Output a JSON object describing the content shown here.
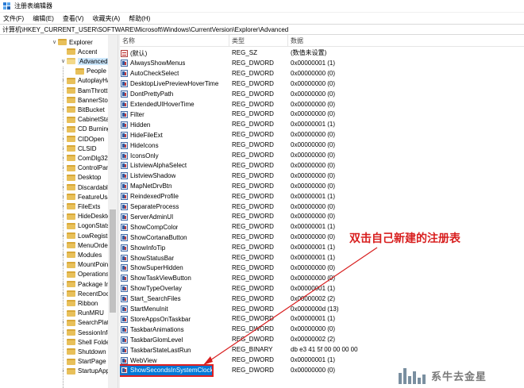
{
  "window": {
    "title": "注册表编辑器"
  },
  "menu": [
    "文件(F)",
    "编辑(E)",
    "查看(V)",
    "收藏夹(A)",
    "帮助(H)"
  ],
  "address": "计算机\\HKEY_CURRENT_USER\\SOFTWARE\\Microsoft\\Windows\\CurrentVersion\\Explorer\\Advanced",
  "tree": {
    "items": [
      {
        "label": "Explorer",
        "indent": 0,
        "chevron": "down",
        "selected": false
      },
      {
        "label": "Accent",
        "indent": 1,
        "chevron": "",
        "selected": false
      },
      {
        "label": "Advanced",
        "indent": 1,
        "chevron": "down",
        "selected": true
      },
      {
        "label": "People",
        "indent": 2,
        "chevron": "",
        "selected": false
      },
      {
        "label": "AutoplayHa",
        "indent": 1,
        "chevron": "right",
        "selected": false
      },
      {
        "label": "BamThrottl",
        "indent": 1,
        "chevron": "",
        "selected": false
      },
      {
        "label": "BannerStor",
        "indent": 1,
        "chevron": "",
        "selected": false
      },
      {
        "label": "BitBucket",
        "indent": 1,
        "chevron": "right",
        "selected": false
      },
      {
        "label": "CabinetSta",
        "indent": 1,
        "chevron": "",
        "selected": false
      },
      {
        "label": "CD Burning",
        "indent": 1,
        "chevron": "right",
        "selected": false
      },
      {
        "label": "CIDOpen",
        "indent": 1,
        "chevron": "right",
        "selected": false
      },
      {
        "label": "CLSID",
        "indent": 1,
        "chevron": "right",
        "selected": false
      },
      {
        "label": "ComDlg32",
        "indent": 1,
        "chevron": "right",
        "selected": false
      },
      {
        "label": "ControlPan",
        "indent": 1,
        "chevron": "right",
        "selected": false
      },
      {
        "label": "Desktop",
        "indent": 1,
        "chevron": "",
        "selected": false
      },
      {
        "label": "Discardabl",
        "indent": 1,
        "chevron": "right",
        "selected": false
      },
      {
        "label": "FeatureUsa",
        "indent": 1,
        "chevron": "right",
        "selected": false
      },
      {
        "label": "FileExts",
        "indent": 1,
        "chevron": "right",
        "selected": false
      },
      {
        "label": "HideDeskto",
        "indent": 1,
        "chevron": "right",
        "selected": false
      },
      {
        "label": "LogonStats",
        "indent": 1,
        "chevron": "",
        "selected": false
      },
      {
        "label": "LowRegistr",
        "indent": 1,
        "chevron": "right",
        "selected": false
      },
      {
        "label": "MenuOrde",
        "indent": 1,
        "chevron": "right",
        "selected": false
      },
      {
        "label": "Modules",
        "indent": 1,
        "chevron": "right",
        "selected": false
      },
      {
        "label": "MountPoin",
        "indent": 1,
        "chevron": "right",
        "selected": false
      },
      {
        "label": "Operations",
        "indent": 1,
        "chevron": "",
        "selected": false
      },
      {
        "label": "Package In",
        "indent": 1,
        "chevron": "right",
        "selected": false
      },
      {
        "label": "RecentDoc",
        "indent": 1,
        "chevron": "right",
        "selected": false
      },
      {
        "label": "Ribbon",
        "indent": 1,
        "chevron": "",
        "selected": false
      },
      {
        "label": "RunMRU",
        "indent": 1,
        "chevron": "",
        "selected": false
      },
      {
        "label": "SearchPlatf",
        "indent": 1,
        "chevron": "right",
        "selected": false
      },
      {
        "label": "SessionInfo",
        "indent": 1,
        "chevron": "right",
        "selected": false
      },
      {
        "label": "Shell Folde",
        "indent": 1,
        "chevron": "",
        "selected": false
      },
      {
        "label": "Shutdown",
        "indent": 1,
        "chevron": "",
        "selected": false
      },
      {
        "label": "StartPage",
        "indent": 1,
        "chevron": "",
        "selected": false
      },
      {
        "label": "StartupApp",
        "indent": 1,
        "chevron": "right",
        "selected": false
      }
    ]
  },
  "list": {
    "columns": [
      "名称",
      "类型",
      "数据"
    ],
    "rows": [
      {
        "name": "(默认)",
        "type": "REG_SZ",
        "data": "(数值未设置)",
        "kind": "str"
      },
      {
        "name": "AlwaysShowMenus",
        "type": "REG_DWORD",
        "data": "0x00000001 (1)",
        "kind": "dword"
      },
      {
        "name": "AutoCheckSelect",
        "type": "REG_DWORD",
        "data": "0x00000000 (0)",
        "kind": "dword"
      },
      {
        "name": "DesktopLivePreviewHoverTime",
        "type": "REG_DWORD",
        "data": "0x00000000 (0)",
        "kind": "dword"
      },
      {
        "name": "DontPrettyPath",
        "type": "REG_DWORD",
        "data": "0x00000000 (0)",
        "kind": "dword"
      },
      {
        "name": "ExtendedUIHoverTime",
        "type": "REG_DWORD",
        "data": "0x00000000 (0)",
        "kind": "dword"
      },
      {
        "name": "Filter",
        "type": "REG_DWORD",
        "data": "0x00000000 (0)",
        "kind": "dword"
      },
      {
        "name": "Hidden",
        "type": "REG_DWORD",
        "data": "0x00000001 (1)",
        "kind": "dword"
      },
      {
        "name": "HideFileExt",
        "type": "REG_DWORD",
        "data": "0x00000000 (0)",
        "kind": "dword"
      },
      {
        "name": "HideIcons",
        "type": "REG_DWORD",
        "data": "0x00000000 (0)",
        "kind": "dword"
      },
      {
        "name": "IconsOnly",
        "type": "REG_DWORD",
        "data": "0x00000000 (0)",
        "kind": "dword"
      },
      {
        "name": "ListviewAlphaSelect",
        "type": "REG_DWORD",
        "data": "0x00000000 (0)",
        "kind": "dword"
      },
      {
        "name": "ListviewShadow",
        "type": "REG_DWORD",
        "data": "0x00000000 (0)",
        "kind": "dword"
      },
      {
        "name": "MapNetDrvBtn",
        "type": "REG_DWORD",
        "data": "0x00000000 (0)",
        "kind": "dword"
      },
      {
        "name": "ReindexedProfile",
        "type": "REG_DWORD",
        "data": "0x00000001 (1)",
        "kind": "dword"
      },
      {
        "name": "SeparateProcess",
        "type": "REG_DWORD",
        "data": "0x00000000 (0)",
        "kind": "dword"
      },
      {
        "name": "ServerAdminUI",
        "type": "REG_DWORD",
        "data": "0x00000000 (0)",
        "kind": "dword"
      },
      {
        "name": "ShowCompColor",
        "type": "REG_DWORD",
        "data": "0x00000001 (1)",
        "kind": "dword"
      },
      {
        "name": "ShowCortanaButton",
        "type": "REG_DWORD",
        "data": "0x00000000 (0)",
        "kind": "dword"
      },
      {
        "name": "ShowInfoTip",
        "type": "REG_DWORD",
        "data": "0x00000001 (1)",
        "kind": "dword"
      },
      {
        "name": "ShowStatusBar",
        "type": "REG_DWORD",
        "data": "0x00000001 (1)",
        "kind": "dword"
      },
      {
        "name": "ShowSuperHidden",
        "type": "REG_DWORD",
        "data": "0x00000000 (0)",
        "kind": "dword"
      },
      {
        "name": "ShowTaskViewButton",
        "type": "REG_DWORD",
        "data": "0x00000000 (0)",
        "kind": "dword"
      },
      {
        "name": "ShowTypeOverlay",
        "type": "REG_DWORD",
        "data": "0x00000001 (1)",
        "kind": "dword"
      },
      {
        "name": "Start_SearchFiles",
        "type": "REG_DWORD",
        "data": "0x00000002 (2)",
        "kind": "dword"
      },
      {
        "name": "StartMenuInit",
        "type": "REG_DWORD",
        "data": "0x0000000d (13)",
        "kind": "dword"
      },
      {
        "name": "StoreAppsOnTaskbar",
        "type": "REG_DWORD",
        "data": "0x00000001 (1)",
        "kind": "dword"
      },
      {
        "name": "TaskbarAnimations",
        "type": "REG_DWORD",
        "data": "0x00000000 (0)",
        "kind": "dword"
      },
      {
        "name": "TaskbarGlomLevel",
        "type": "REG_DWORD",
        "data": "0x00000002 (2)",
        "kind": "dword"
      },
      {
        "name": "TaskbarStateLastRun",
        "type": "REG_BINARY",
        "data": "db e3 41 5f 00 00 00 00",
        "kind": "dword"
      },
      {
        "name": "WebView",
        "type": "REG_DWORD",
        "data": "0x00000001 (1)",
        "kind": "dword"
      },
      {
        "name": "ShowSecondsInSystemClock",
        "type": "REG_DWORD",
        "data": "0x00000000 (0)",
        "kind": "dword",
        "highlight": true
      }
    ]
  },
  "annotation": {
    "text": "双击自己新建的注册表",
    "color": "#d81e1e"
  },
  "watermark": {
    "text": "系牛去金星"
  },
  "colors": {
    "selection": "#0078d7",
    "tree_selection": "#cce8ff",
    "annotation": "#d81e1e"
  }
}
